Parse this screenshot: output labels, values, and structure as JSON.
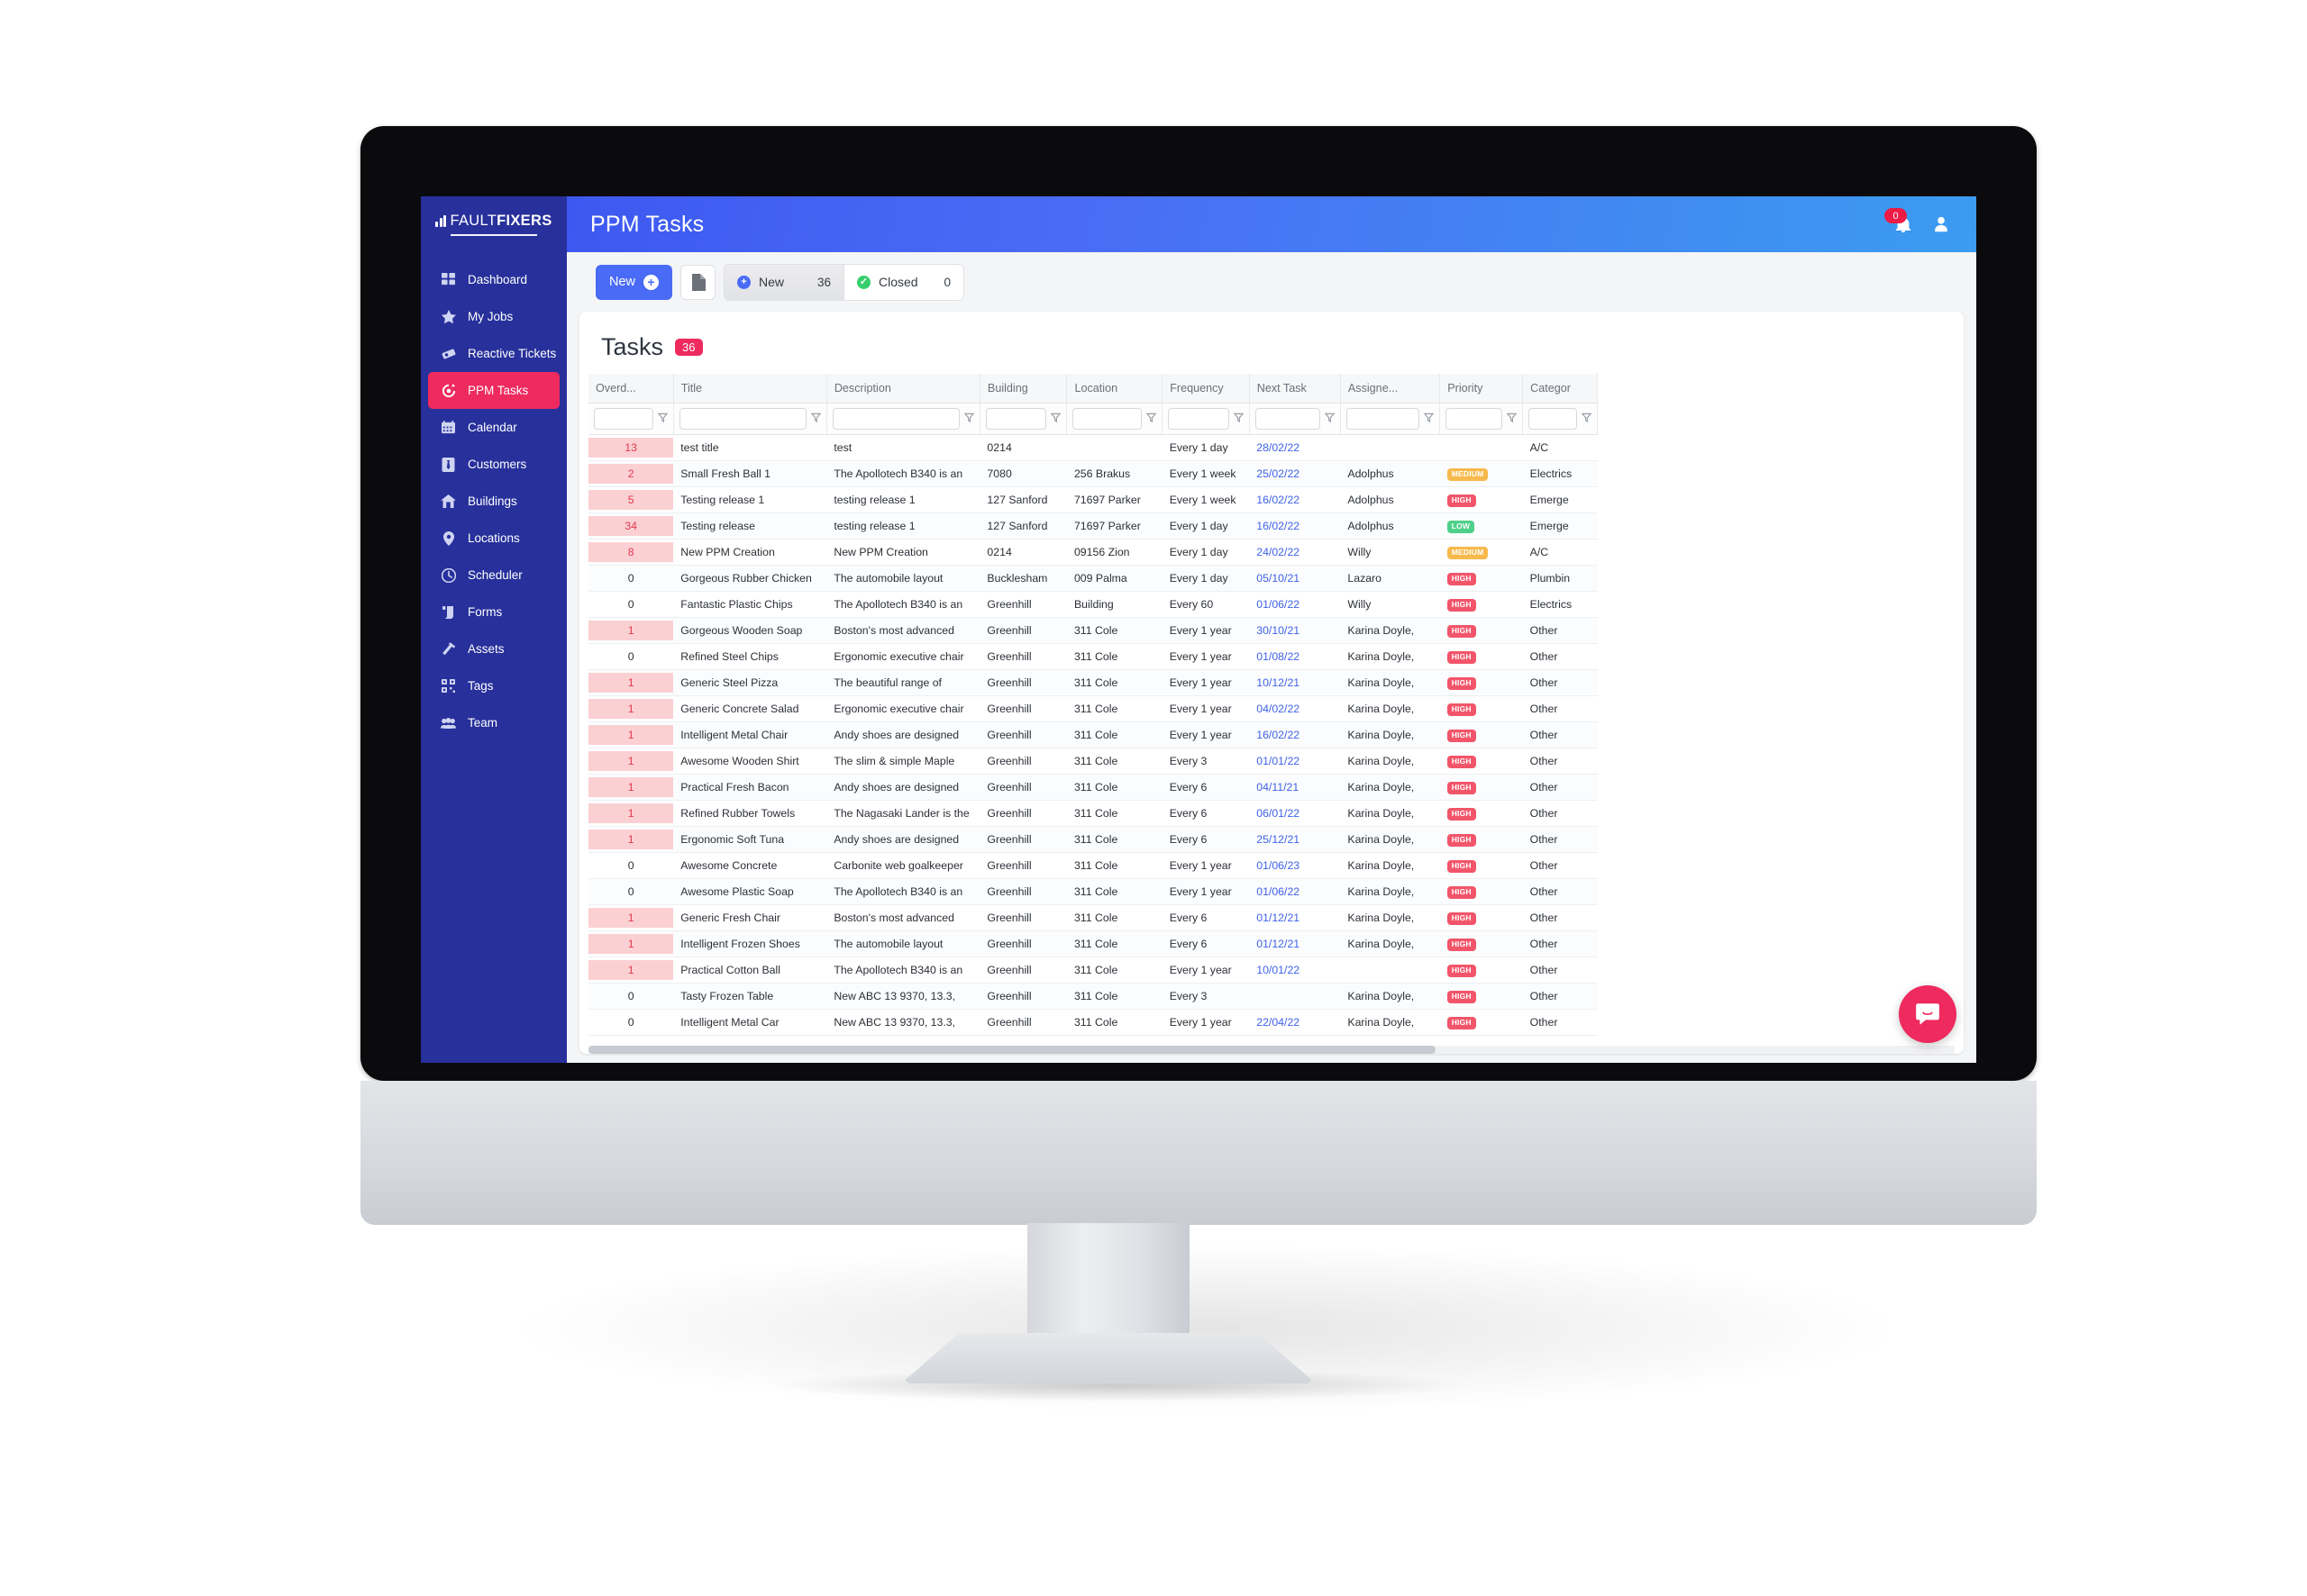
{
  "brand": {
    "name_light": "FAULT",
    "name_bold": "FIXERS",
    "logo_icon": "bar-chart-icon"
  },
  "header": {
    "page_title": "PPM Tasks",
    "notification_count": "0",
    "bell_icon": "bell-icon",
    "avatar_icon": "user-icon"
  },
  "sidebar": {
    "items": [
      {
        "label": "Dashboard",
        "icon": "grid-icon",
        "active": false
      },
      {
        "label": "My Jobs",
        "icon": "star-icon",
        "active": false
      },
      {
        "label": "Reactive Tickets",
        "icon": "ticket-icon",
        "active": false
      },
      {
        "label": "PPM Tasks",
        "icon": "refresh-gear-icon",
        "active": true
      },
      {
        "label": "Calendar",
        "icon": "calendar-icon",
        "active": false
      },
      {
        "label": "Customers",
        "icon": "tie-icon",
        "active": false
      },
      {
        "label": "Buildings",
        "icon": "home-icon",
        "active": false
      },
      {
        "label": "Locations",
        "icon": "pin-icon",
        "active": false
      },
      {
        "label": "Scheduler",
        "icon": "clock-icon",
        "active": false
      },
      {
        "label": "Forms",
        "icon": "scroll-icon",
        "active": false
      },
      {
        "label": "Assets",
        "icon": "hammer-icon",
        "active": false
      },
      {
        "label": "Tags",
        "icon": "qr-icon",
        "active": false
      },
      {
        "label": "Team",
        "icon": "people-icon",
        "active": false
      }
    ]
  },
  "toolbar": {
    "new_label": "New",
    "new_plus": "+",
    "doc_icon": "document-icon",
    "tabs": [
      {
        "label": "New",
        "count": "36",
        "icon": "plus-circle-icon",
        "selected": true
      },
      {
        "label": "Closed",
        "count": "0",
        "icon": "check-circle-icon",
        "selected": false
      }
    ]
  },
  "card": {
    "title": "Tasks",
    "count_badge": "36"
  },
  "table": {
    "columns": [
      "Overd...",
      "Title",
      "Description",
      "Building",
      "Location",
      "Frequency",
      "Next Task",
      "Assigne...",
      "Priority",
      "Categor"
    ],
    "filter_placeholders": [
      "",
      "",
      "",
      "",
      "",
      "",
      "",
      "",
      "",
      ""
    ],
    "filter_values": [
      "",
      "",
      "",
      "",
      "",
      "",
      "",
      "",
      "",
      ""
    ],
    "filter_icon": "funnel-icon",
    "rows": [
      {
        "overdue": "13",
        "title": "test title",
        "description": "test",
        "building": "0214",
        "location": "",
        "frequency": "Every 1 day",
        "next_task": "28/02/22",
        "assignee": "",
        "priority": "",
        "category": "A/C"
      },
      {
        "overdue": "2",
        "title": "Small Fresh Ball 1",
        "description": "The Apollotech B340 is an",
        "building": "7080",
        "location": "256 Brakus",
        "frequency": "Every 1 week",
        "next_task": "25/02/22",
        "assignee": "Adolphus",
        "priority": "MEDIUM",
        "category": "Electrics"
      },
      {
        "overdue": "5",
        "title": "Testing release 1",
        "description": "testing release 1",
        "building": "127 Sanford",
        "location": "71697 Parker",
        "frequency": "Every 1 week",
        "next_task": "16/02/22",
        "assignee": "Adolphus",
        "priority": "HIGH",
        "category": "Emerge"
      },
      {
        "overdue": "34",
        "title": "Testing release",
        "description": "testing release 1",
        "building": "127 Sanford",
        "location": "71697 Parker",
        "frequency": "Every 1 day",
        "next_task": "16/02/22",
        "assignee": "Adolphus",
        "priority": "LOW",
        "category": "Emerge"
      },
      {
        "overdue": "8",
        "title": "New PPM Creation",
        "description": "New PPM Creation",
        "building": "0214",
        "location": "09156 Zion",
        "frequency": "Every 1 day",
        "next_task": "24/02/22",
        "assignee": "Willy",
        "priority": "MEDIUM",
        "category": "A/C"
      },
      {
        "overdue": "0",
        "title": "Gorgeous Rubber Chicken",
        "description": "The automobile layout",
        "building": "Bucklesham",
        "location": "009 Palma",
        "frequency": "Every 1 day",
        "next_task": "05/10/21",
        "assignee": "Lazaro",
        "priority": "HIGH",
        "category": "Plumbin"
      },
      {
        "overdue": "0",
        "title": "Fantastic Plastic Chips",
        "description": "The Apollotech B340 is an",
        "building": "Greenhill",
        "location": "Building",
        "frequency": "Every 60",
        "next_task": "01/06/22",
        "assignee": "Willy",
        "priority": "HIGH",
        "category": "Electrics"
      },
      {
        "overdue": "1",
        "title": "Gorgeous Wooden Soap",
        "description": "Boston's most advanced",
        "building": "Greenhill",
        "location": "311 Cole",
        "frequency": "Every 1 year",
        "next_task": "30/10/21",
        "assignee": "Karina Doyle,",
        "priority": "HIGH",
        "category": "Other"
      },
      {
        "overdue": "0",
        "title": "Refined Steel Chips",
        "description": "Ergonomic executive chair",
        "building": "Greenhill",
        "location": "311 Cole",
        "frequency": "Every 1 year",
        "next_task": "01/08/22",
        "assignee": "Karina Doyle,",
        "priority": "HIGH",
        "category": "Other"
      },
      {
        "overdue": "1",
        "title": "Generic Steel Pizza",
        "description": "The beautiful range of",
        "building": "Greenhill",
        "location": "311 Cole",
        "frequency": "Every 1 year",
        "next_task": "10/12/21",
        "assignee": "Karina Doyle,",
        "priority": "HIGH",
        "category": "Other"
      },
      {
        "overdue": "1",
        "title": "Generic Concrete Salad",
        "description": "Ergonomic executive chair",
        "building": "Greenhill",
        "location": "311 Cole",
        "frequency": "Every 1 year",
        "next_task": "04/02/22",
        "assignee": "Karina Doyle,",
        "priority": "HIGH",
        "category": "Other"
      },
      {
        "overdue": "1",
        "title": "Intelligent Metal Chair",
        "description": "Andy shoes are designed",
        "building": "Greenhill",
        "location": "311 Cole",
        "frequency": "Every 1 year",
        "next_task": "16/02/22",
        "assignee": "Karina Doyle,",
        "priority": "HIGH",
        "category": "Other"
      },
      {
        "overdue": "1",
        "title": "Awesome Wooden Shirt",
        "description": "The slim & simple Maple",
        "building": "Greenhill",
        "location": "311 Cole",
        "frequency": "Every 3",
        "next_task": "01/01/22",
        "assignee": "Karina Doyle,",
        "priority": "HIGH",
        "category": "Other"
      },
      {
        "overdue": "1",
        "title": "Practical Fresh Bacon",
        "description": "Andy shoes are designed",
        "building": "Greenhill",
        "location": "311 Cole",
        "frequency": "Every 6",
        "next_task": "04/11/21",
        "assignee": "Karina Doyle,",
        "priority": "HIGH",
        "category": "Other"
      },
      {
        "overdue": "1",
        "title": "Refined Rubber Towels",
        "description": "The Nagasaki Lander is the",
        "building": "Greenhill",
        "location": "311 Cole",
        "frequency": "Every 6",
        "next_task": "06/01/22",
        "assignee": "Karina Doyle,",
        "priority": "HIGH",
        "category": "Other"
      },
      {
        "overdue": "1",
        "title": "Ergonomic Soft Tuna",
        "description": "Andy shoes are designed",
        "building": "Greenhill",
        "location": "311 Cole",
        "frequency": "Every 6",
        "next_task": "25/12/21",
        "assignee": "Karina Doyle,",
        "priority": "HIGH",
        "category": "Other"
      },
      {
        "overdue": "0",
        "title": "Awesome Concrete",
        "description": "Carbonite web goalkeeper",
        "building": "Greenhill",
        "location": "311 Cole",
        "frequency": "Every 1 year",
        "next_task": "01/06/23",
        "assignee": "Karina Doyle,",
        "priority": "HIGH",
        "category": "Other"
      },
      {
        "overdue": "0",
        "title": "Awesome Plastic Soap",
        "description": "The Apollotech B340 is an",
        "building": "Greenhill",
        "location": "311 Cole",
        "frequency": "Every 1 year",
        "next_task": "01/06/22",
        "assignee": "Karina Doyle,",
        "priority": "HIGH",
        "category": "Other"
      },
      {
        "overdue": "1",
        "title": "Generic Fresh Chair",
        "description": "Boston's most advanced",
        "building": "Greenhill",
        "location": "311 Cole",
        "frequency": "Every 6",
        "next_task": "01/12/21",
        "assignee": "Karina Doyle,",
        "priority": "HIGH",
        "category": "Other"
      },
      {
        "overdue": "1",
        "title": "Intelligent Frozen Shoes",
        "description": "The automobile layout",
        "building": "Greenhill",
        "location": "311 Cole",
        "frequency": "Every 6",
        "next_task": "01/12/21",
        "assignee": "Karina Doyle,",
        "priority": "HIGH",
        "category": "Other"
      },
      {
        "overdue": "1",
        "title": "Practical Cotton Ball",
        "description": "The Apollotech B340 is an",
        "building": "Greenhill",
        "location": "311 Cole",
        "frequency": "Every 1 year",
        "next_task": "10/01/22",
        "assignee": "",
        "priority": "HIGH",
        "category": "Other"
      },
      {
        "overdue": "0",
        "title": "Tasty Frozen Table",
        "description": "New ABC 13 9370, 13.3,",
        "building": "Greenhill",
        "location": "311 Cole",
        "frequency": "Every 3",
        "next_task": "",
        "assignee": "Karina Doyle,",
        "priority": "HIGH",
        "category": "Other"
      },
      {
        "overdue": "0",
        "title": "Intelligent Metal Car",
        "description": "New ABC 13 9370, 13.3,",
        "building": "Greenhill",
        "location": "311 Cole",
        "frequency": "Every 1 year",
        "next_task": "22/04/22",
        "assignee": "Karina Doyle,",
        "priority": "HIGH",
        "category": "Other"
      }
    ]
  },
  "chat": {
    "icon": "chat-bubble-icon"
  },
  "colors": {
    "sidebar": "#27309b",
    "accent_pink": "#ee2a5e",
    "accent_blue": "#4a6bf5",
    "high": "#f2556a",
    "medium": "#f7b94c",
    "low": "#4fd08a",
    "overdue_bg": "#fbd0d3"
  }
}
